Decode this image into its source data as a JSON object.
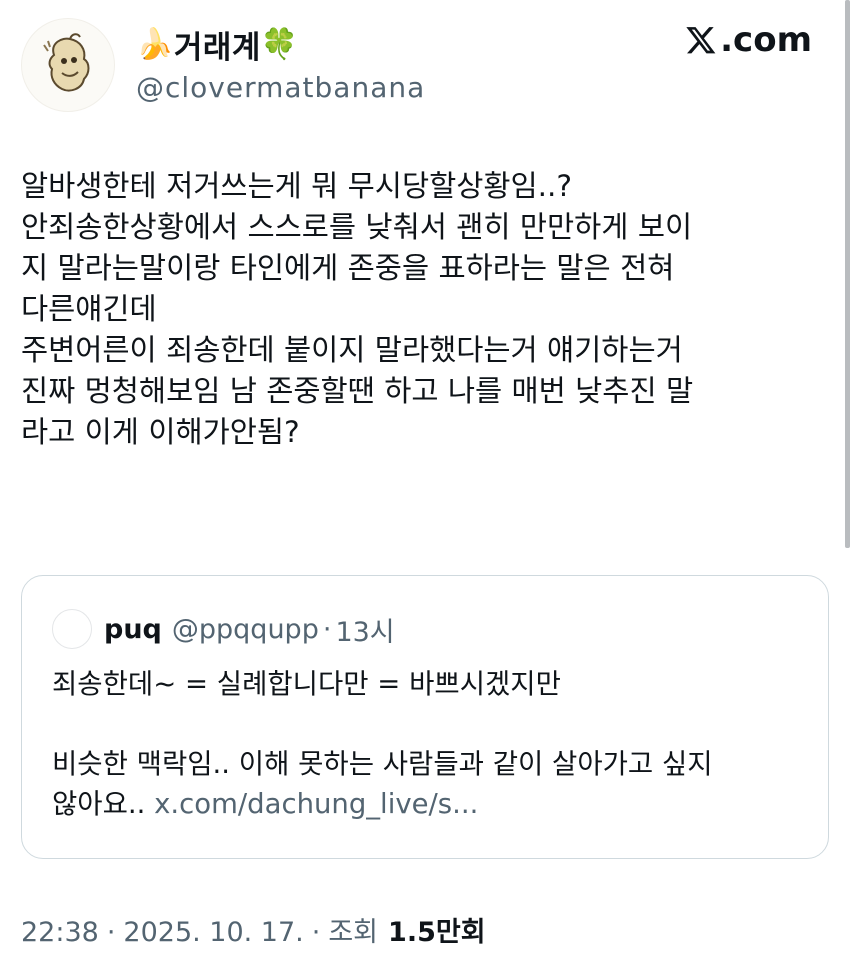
{
  "header": {
    "display_name": "거래계",
    "name_prefix_emoji": "🍌",
    "name_suffix_emoji": "🍀",
    "handle": "@clovermatbanana",
    "brand": ".com"
  },
  "tweet": {
    "lines": [
      "알바생한테 저거쓰는게 뭐 무시당할상황임..?",
      "안죄송한상황에서 스스로를 낮춰서 괜히 만만하게 보이",
      "지 말라는말이랑 타인에게 존중을 표하라는 말은 전혀",
      "다른얘긴데",
      "주변어른이 죄송한데 붙이지 말라했다는거 얘기하는거",
      "진짜 멍청해보임 남 존중할땐 하고 나를 매번 낮추진 말",
      "라고 이게 이해가안됨?"
    ]
  },
  "quote": {
    "name": "puq",
    "handle": "@ppqqupp",
    "dot": "·",
    "time": "13시",
    "line1": "죄송한데~ = 실례합니다만 = 바쁘시겠지만",
    "line2": "",
    "line3": "비슷한 맥락임.. 이해 못하는 사람들과 같이 살아가고 싶지",
    "line4_text": "않아요.. ",
    "line4_link": "x.com/dachung_live/s..."
  },
  "meta": {
    "time": "22:38",
    "sep1": "·",
    "date": "2025. 10. 17.",
    "sep2": "·",
    "views_label": "조회",
    "views_number": "1.5",
    "views_unit": "만회"
  },
  "colors": {
    "text": "#0f1419",
    "secondary": "#536471",
    "border": "#cfd9de"
  },
  "icons": [
    "avatar-sketch",
    "x-logo",
    "banana-emoji",
    "clover-emoji"
  ]
}
